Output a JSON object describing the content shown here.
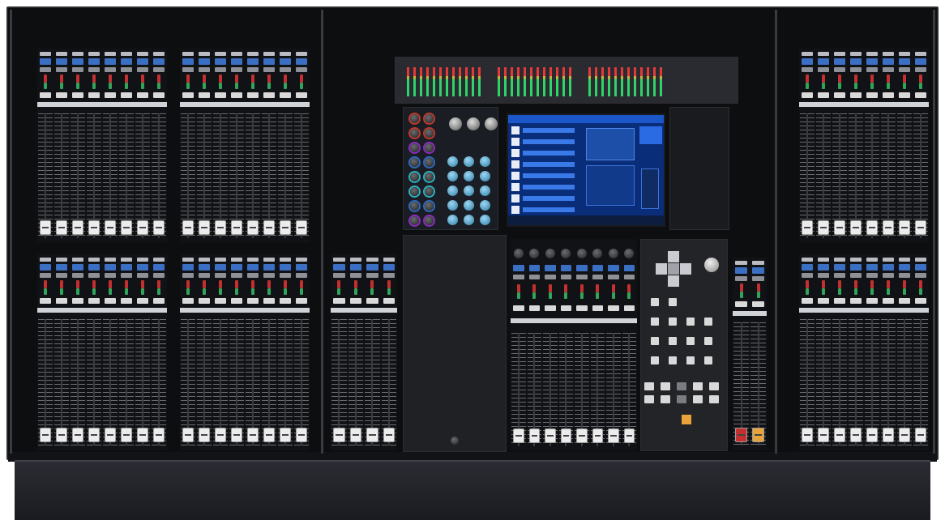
{
  "colors": {
    "frame": "#0d0e10",
    "select_button": "#3a6fc4",
    "mute_red": "#c43030",
    "cue_green": "#2fa45a",
    "fader_cap": "#ececec",
    "screen_blue": "#0a2d7a",
    "meter_green": "#2fd36a",
    "meter_red": "#e23a3a",
    "key_orange": "#e8a43a"
  },
  "icons": {
    "knob": "rotary-knob-icon",
    "fader": "fader-cap-icon",
    "meter": "level-meter-icon",
    "dpad": "dpad-icon"
  },
  "bays": [
    {
      "id": "left-bay-top-a",
      "channels": 8
    },
    {
      "id": "left-bay-top-b",
      "channels": 8
    },
    {
      "id": "left-bay-bottom-a",
      "channels": 8
    },
    {
      "id": "left-bay-bottom-b",
      "channels": 8
    },
    {
      "id": "center-left-bay",
      "channels": 4
    },
    {
      "id": "center-fader-bay",
      "channels": 8
    },
    {
      "id": "center-right-bay",
      "channels": 2
    },
    {
      "id": "right-bay-top",
      "channels": 8
    },
    {
      "id": "right-bay-bottom",
      "channels": 8
    }
  ]
}
